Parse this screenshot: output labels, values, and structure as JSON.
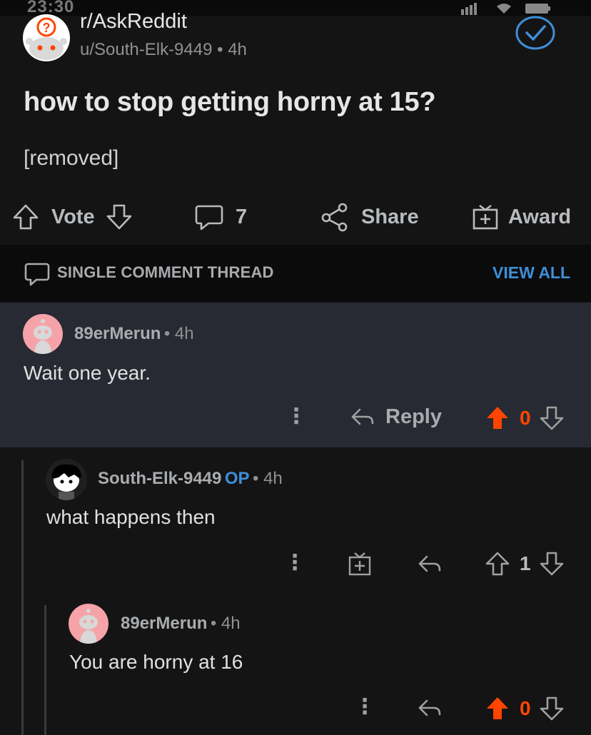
{
  "status": {
    "time": "23:30"
  },
  "post": {
    "subreddit": "r/AskReddit",
    "author": "u/South-Elk-9449",
    "age": "4h",
    "title": "how to stop getting horny at 15?",
    "body": "[removed]"
  },
  "actions": {
    "vote_label": "Vote",
    "comments_count": "7",
    "share_label": "Share",
    "award_label": "Award"
  },
  "thread": {
    "label": "SINGLE COMMENT THREAD",
    "view_all": "VIEW ALL"
  },
  "comments": [
    {
      "user": "89erMerun",
      "age": "4h",
      "text": "Wait one year.",
      "reply_label": "Reply",
      "score": "0"
    },
    {
      "user": "South-Elk-9449",
      "op_badge": "OP",
      "age": "4h",
      "text": "what happens then",
      "score": "1"
    },
    {
      "user": "89erMerun",
      "age": "4h",
      "text": "You are horny at 16",
      "score": "0"
    }
  ],
  "colors": {
    "background": "#141414",
    "highlight": "#272a33",
    "upvoted": "#ff4500",
    "link": "#3d8fd9"
  },
  "icons": [
    "question-icon",
    "checkmark-icon",
    "upvote-icon",
    "downvote-icon",
    "comment-icon",
    "share-icon",
    "gift-icon",
    "reply-icon",
    "more-icon"
  ]
}
